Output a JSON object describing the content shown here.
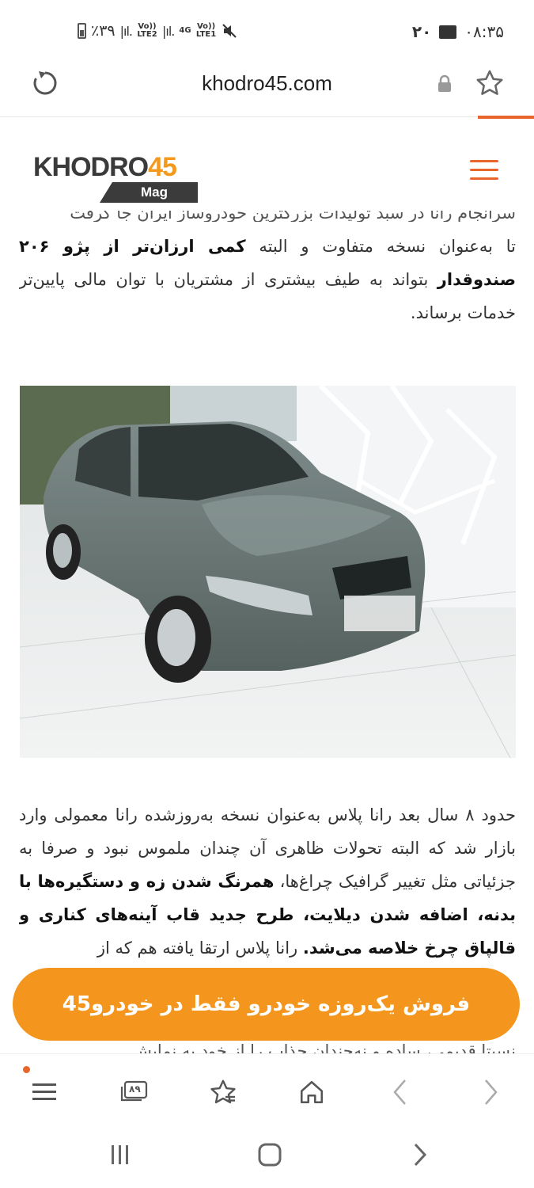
{
  "status_bar": {
    "battery": "٪۳۹",
    "net1": "Vo)) LTE2",
    "net2_gen": "4G",
    "net2": "Vo)) LTE1",
    "notif_count": "۲۰",
    "time": "۰۸:۳۵"
  },
  "browser": {
    "url": "khodro45.com"
  },
  "site": {
    "logo_word": "KHODRO",
    "logo_number": "45",
    "logo_tag": "Mag"
  },
  "article": {
    "para1_cut": "سرانجام رانا در سبد تولیدات بزرگترین خودروساز ایران جا گرفت",
    "para1_a": "تا به‌عنوان نسخه متفاوت و البته ",
    "para1_bold": "کمی ارزان‌تر از پژو ۲۰۶ صندوقدار",
    "para1_b": " بتواند به طیف بیشتری از مشتریان با توان مالی پایین‌تر خدمات برساند.",
    "para2_a": "حدود ۸ سال بعد رانا پلاس به‌عنوان نسخه به‌روزشده رانا معمولی وارد بازار شد که البته تحولات ظاهری آن چندان ملموس نبود و صرفا به جزئیاتی مثل تغییر گرافیک چراغ‌ها، ",
    "para2_bold": "همرنگ شدن زه و دستگیره‌ها با بدنه، اضافه شدن دیلایت، طرح جدید قاب آینه‌های کناری و قالپاق چرخ خلاصه می‌شد.",
    "para2_b": " رانا پلاس ارتقا یافته هم که از",
    "para2_tail": "نسبتا قدیمی، ساده و نه‌چندان جذاب را از خود به نمایش"
  },
  "cta": {
    "label": "فروش یک‌روزه خودرو فقط در خودرو45"
  },
  "bottom_toolbar": {
    "tabs_count": "۸۹"
  },
  "icons": {
    "reload": "reload-icon",
    "lock": "lock-icon",
    "bookmark": "star-icon",
    "menu": "hamburger-menu-icon",
    "tabs": "tabs-icon",
    "bookmarks": "bookmarks-icon",
    "home": "home-icon",
    "back": "back-arrow-icon",
    "forward": "forward-arrow-icon"
  },
  "colors": {
    "accent": "#e8662b",
    "cta": "#f4961d",
    "logo_dark": "#3a3a3a"
  }
}
